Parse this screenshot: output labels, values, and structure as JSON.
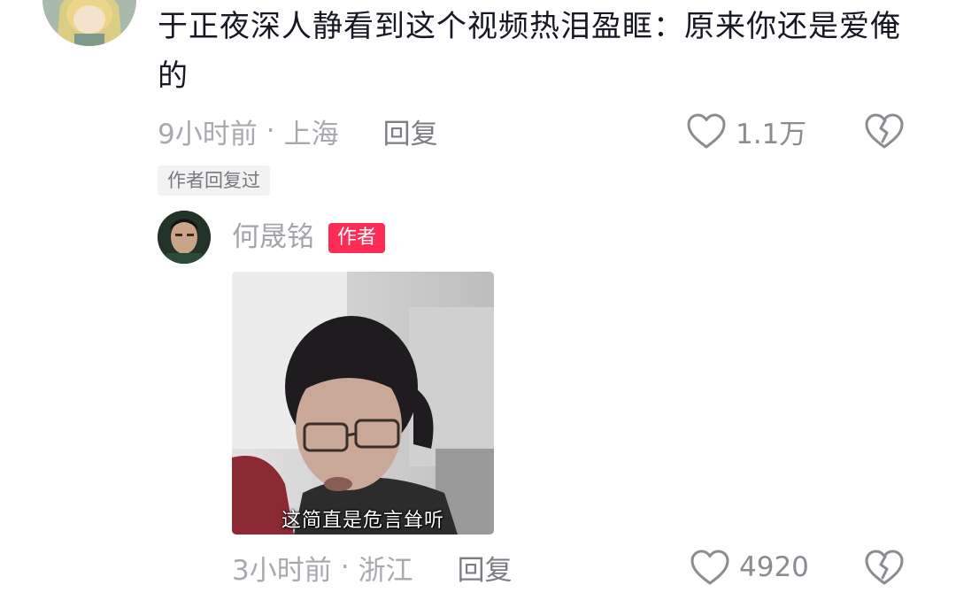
{
  "comment": {
    "text": "于正夜深人静看到这个视频热泪盈眶：原来你还是爱俺的",
    "time": "9小时前",
    "separator": "·",
    "location": "上海",
    "reply_label": "回复",
    "like_count": "1.1万",
    "author_replied_tag": "作者回复过"
  },
  "reply": {
    "username": "何晟铭",
    "author_badge": "作者",
    "sticker_caption": "这简直是危言耸听",
    "time": "3小时前",
    "separator": "·",
    "location": "浙江",
    "reply_label": "回复",
    "like_count": "4920"
  },
  "colors": {
    "primary_text": "#161823",
    "secondary_text": "#a7a9ae",
    "author_badge_bg": "#fe2c55"
  },
  "icons": {
    "like": "heart-outline-icon",
    "dislike": "broken-heart-icon"
  }
}
